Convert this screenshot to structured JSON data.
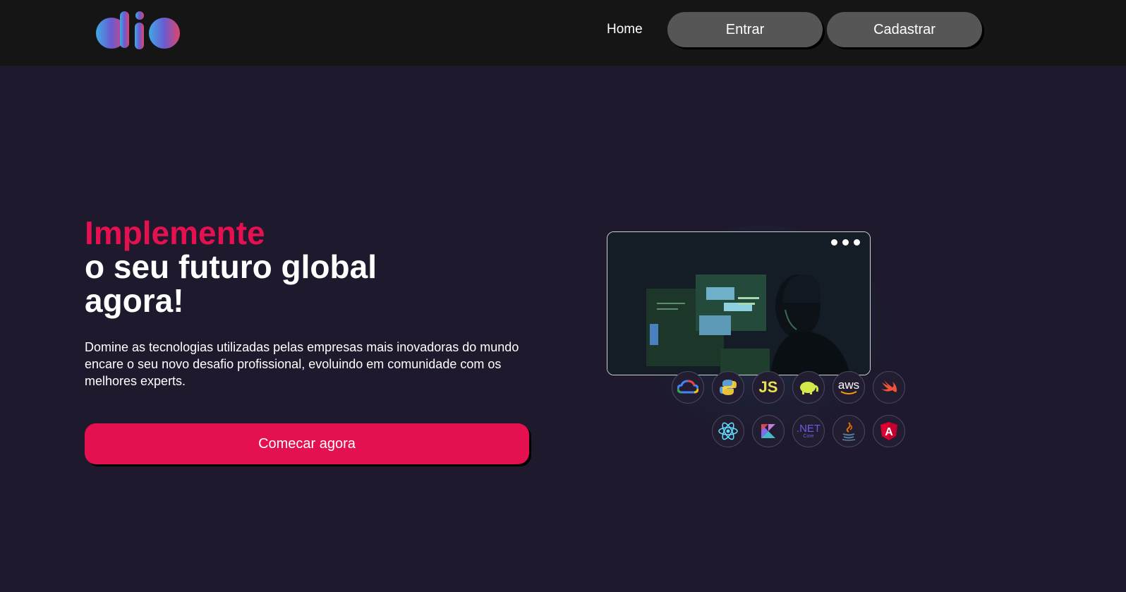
{
  "header": {
    "logo_alt": "dio",
    "nav": {
      "home_label": "Home",
      "login_label": "Entrar",
      "signup_label": "Cadastrar"
    }
  },
  "hero": {
    "title_accent": "Implemente",
    "title_line2": "o seu futuro global",
    "title_line3": "agora!",
    "description": "Domine as tecnologias utilizadas pelas empresas mais inovadoras do mundo encare o seu novo desafio profissional, evoluindo em comunidade com os melhores experts.",
    "cta_label": "Comecar agora"
  },
  "tech_icons": {
    "row1": [
      "google-cloud",
      "python",
      "javascript",
      "hadoop",
      "aws",
      "swift"
    ],
    "row2": [
      "react",
      "kotlin",
      "dotnet-core",
      "java",
      "angular"
    ],
    "js_text": "JS",
    "aws_text": "aws",
    "net_text": ".NET",
    "net_sub": "Core",
    "angular_text": "A"
  },
  "colors": {
    "background": "#1e192c",
    "header": "#151515",
    "accent": "#e4104f",
    "nav_button": "#565656"
  }
}
